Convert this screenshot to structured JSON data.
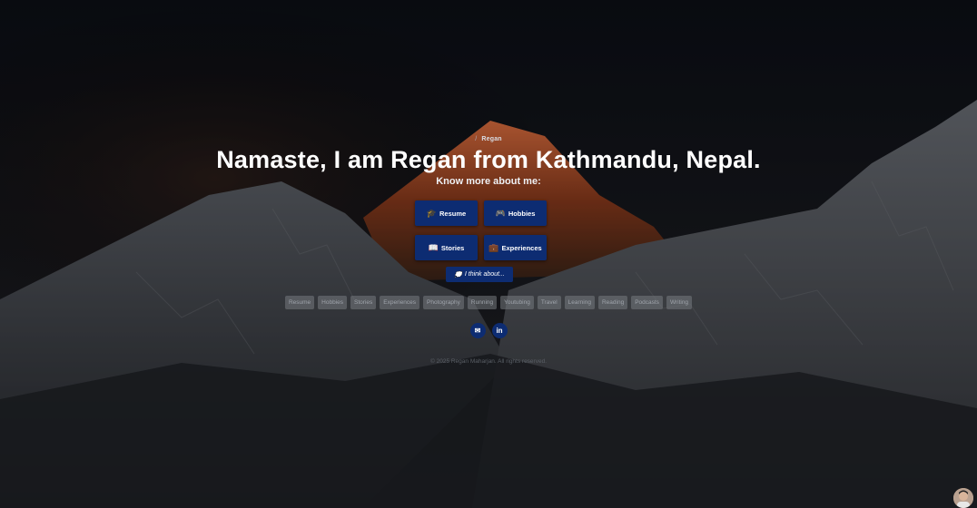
{
  "breadcrumb": {
    "separator": "/",
    "current": "Regan"
  },
  "hero": {
    "title": "Namaste, I am Regan from Kathmandu, Nepal.",
    "subtitle": "Know more about me:"
  },
  "buttons": [
    {
      "label": "Resume",
      "icon": "graduation-cap-icon",
      "glyph": "🎓"
    },
    {
      "label": "Hobbies",
      "icon": "gamepad-icon",
      "glyph": "🎮"
    },
    {
      "label": "Stories",
      "icon": "book-icon",
      "glyph": "📖"
    },
    {
      "label": "Experiences",
      "icon": "briefcase-icon",
      "glyph": "💼"
    }
  ],
  "think": {
    "label": "I think about...",
    "icon": "speech-bubble-icon",
    "glyph": "💭"
  },
  "tags": [
    "Resume",
    "Hobbies",
    "Stories",
    "Experiences",
    "Photography",
    "Running",
    "Youtubing",
    "Travel",
    "Learning",
    "Reading",
    "Podcasts",
    "Writing"
  ],
  "social": [
    {
      "icon": "email-icon",
      "glyph": "✉"
    },
    {
      "icon": "linkedin-icon",
      "glyph": "in"
    }
  ],
  "footer": {
    "copyright": "© 2025 Regan Maharjan. All rights reserved."
  },
  "colors": {
    "button_bg": "#0d2c72",
    "background": "#0d1119",
    "peak_glow": "#c7582a"
  }
}
